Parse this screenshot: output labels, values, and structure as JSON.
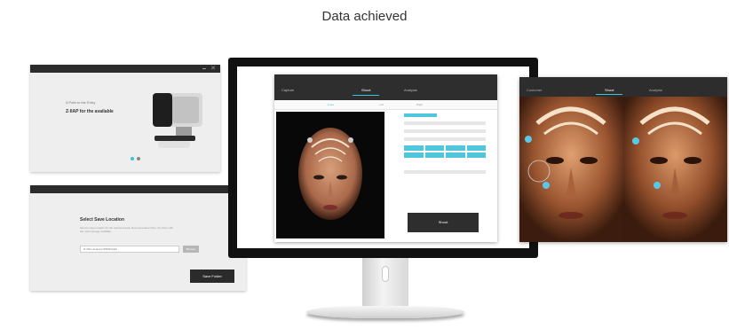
{
  "headline": "Data achieved",
  "install_window": {
    "line1": "A Path to the Entry",
    "line2": "Z-IIAP for the available"
  },
  "save_window": {
    "title": "Select Save Location",
    "description": "Set the save location for the captured data. Recommended drive: the drive with the most storage available.",
    "path_value": "D:\\Skin Analyzer\\PROFILES",
    "browse_label": "Browse",
    "save_label": "Save Folder"
  },
  "capture_app": {
    "tabs": [
      "Capture",
      "Shoot",
      "Analysis"
    ],
    "active_tab": "Shoot",
    "sub_tabs": [
      "Front",
      "Left",
      "Right"
    ],
    "shoot_button": "Shoot"
  },
  "result_window": {
    "tabs": [
      "Customer",
      "Shoot",
      "Analysis"
    ],
    "active_tab": "Shoot"
  },
  "colors": {
    "accent": "#37c5d8",
    "dark": "#2e2e2e"
  }
}
